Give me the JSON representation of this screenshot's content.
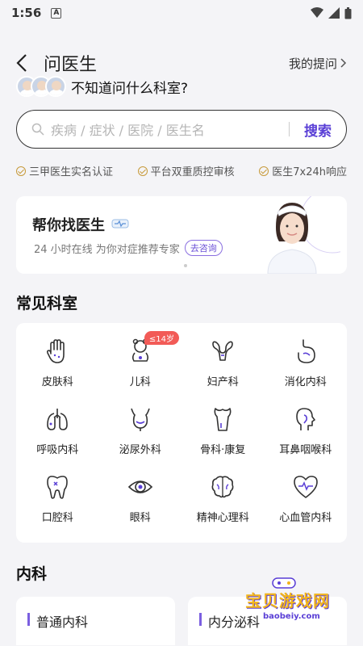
{
  "status_bar": {
    "time": "1:56",
    "a_icon": "A"
  },
  "header": {
    "title": "问医生",
    "my_questions": "我的提问"
  },
  "prompt": {
    "text": "不知道问什么科室?"
  },
  "search": {
    "placeholder": "疾病 / 症状 / 医院 / 医生名",
    "button": "搜索"
  },
  "badges": [
    "三甲医生实名认证",
    "平台双重质控审核",
    "医生7x24h响应"
  ],
  "banner": {
    "title": "帮你找医生",
    "subtitle": "24 小时在线 为你对症推荐专家",
    "consult": "去咨询"
  },
  "common_depts": {
    "title": "常见科室",
    "items": [
      {
        "label": "皮肤科",
        "icon": "hand-icon"
      },
      {
        "label": "儿科",
        "icon": "baby-icon",
        "tag": "≤14岁"
      },
      {
        "label": "妇产科",
        "icon": "uterus-icon"
      },
      {
        "label": "消化内科",
        "icon": "stomach-icon"
      },
      {
        "label": "呼吸内科",
        "icon": "lungs-icon"
      },
      {
        "label": "泌尿外科",
        "icon": "bladder-icon"
      },
      {
        "label": "骨科·康复",
        "icon": "bone-icon"
      },
      {
        "label": "耳鼻咽喉科",
        "icon": "head-profile-icon"
      },
      {
        "label": "口腔科",
        "icon": "tooth-icon"
      },
      {
        "label": "眼科",
        "icon": "eye-icon"
      },
      {
        "label": "精神心理科",
        "icon": "brain-icon"
      },
      {
        "label": "心血管内科",
        "icon": "heart-icon"
      }
    ]
  },
  "internal": {
    "title": "内科",
    "items": [
      "普通内科",
      "内分泌科"
    ]
  },
  "watermark": {
    "text": "宝贝游戏网",
    "url": "baobeiy.com"
  },
  "colors": {
    "accent": "#5a3fd6",
    "badge_check": "#c79a3a",
    "tag": "#f25b57"
  }
}
